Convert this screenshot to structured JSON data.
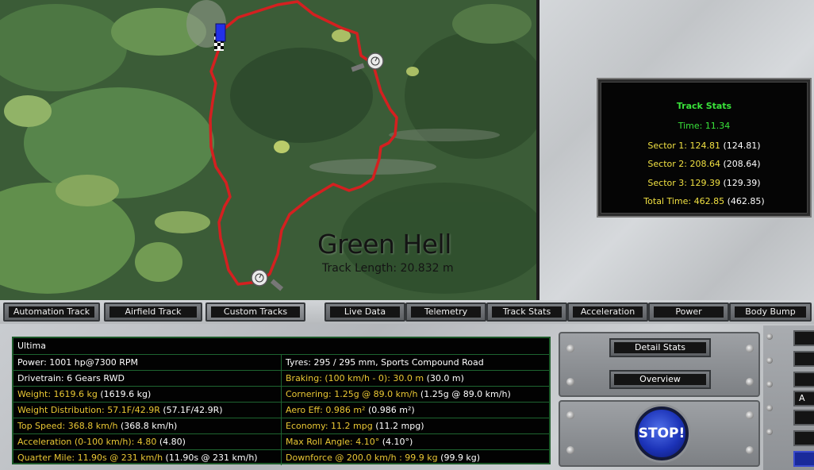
{
  "map": {
    "title": "Green Hell",
    "subtitle": "Track Length: 20.832 m"
  },
  "track_stats": {
    "title": "Track Stats",
    "time": "Time: 11.34",
    "sector1_label": "Sector 1: 124.81",
    "sector1_best": "(124.81)",
    "sector2_label": "Sector 2: 208.64",
    "sector2_best": "(208.64)",
    "sector3_label": "Sector 3: 129.39",
    "sector3_best": "(129.39)",
    "total_label": "Total Time: 462.85",
    "total_best": "(462.85)"
  },
  "tabs": {
    "left": [
      "Automation Track",
      "Airfield Track",
      "Custom Tracks"
    ],
    "right": [
      "Live Data",
      "Telemetry",
      "Track Stats",
      "Acceleration",
      "Power",
      "Body Bump"
    ]
  },
  "specs": {
    "car_name": "Ultima",
    "rows": [
      {
        "l": "Power: 1001 hp@7300 RPM",
        "lb": "",
        "r": "Tyres: 295 / 295 mm, Sports Compound Road",
        "rb": "",
        "lc": "w",
        "rc": "w"
      },
      {
        "l": "Drivetrain: 6 Gears RWD",
        "lb": "",
        "r": "Braking: (100 km/h - 0): 30.0 m",
        "rb": " (30.0 m)",
        "lc": "w",
        "rc": "y"
      },
      {
        "l": "Weight: 1619.6 kg",
        "lb": " (1619.6 kg)",
        "r": "Cornering: 1.25g @ 89.0 km/h",
        "rb": " (1.25g @ 89.0 km/h)",
        "lc": "y",
        "rc": "y"
      },
      {
        "l": "Weight Distribution: 57.1F/42.9R",
        "lb": " (57.1F/42.9R)",
        "r": "Aero Eff: 0.986 m²",
        "rb": " (0.986 m²)",
        "lc": "y",
        "rc": "y"
      },
      {
        "l": "Top Speed: 368.8 km/h",
        "lb": " (368.8 km/h)",
        "r": "Economy: 11.2 mpg",
        "rb": " (11.2 mpg)",
        "lc": "y",
        "rc": "y"
      },
      {
        "l": "Acceleration (0-100 km/h): 4.80",
        "lb": " (4.80)",
        "r": "Max Roll Angle: 4.10°",
        "rb": " (4.10°)",
        "lc": "y",
        "rc": "y"
      },
      {
        "l": "Quarter Mile: 11.90s @ 231 km/h",
        "lb": " (11.90s @ 231 km/h)",
        "r": "Downforce @ 200.0 km/h : 99.9 kg",
        "rb": " (99.9 kg)",
        "lc": "y",
        "rc": "y"
      }
    ]
  },
  "controls": {
    "detail_stats": "Detail Stats",
    "overview": "Overview",
    "stop": "STOP!"
  },
  "edge": {
    "partial_label": "A"
  },
  "colors": {
    "stat_green": "#39e23a",
    "stat_yellow": "#f0e042",
    "spec_yellow": "#e9c734",
    "track_red": "#d42020"
  }
}
